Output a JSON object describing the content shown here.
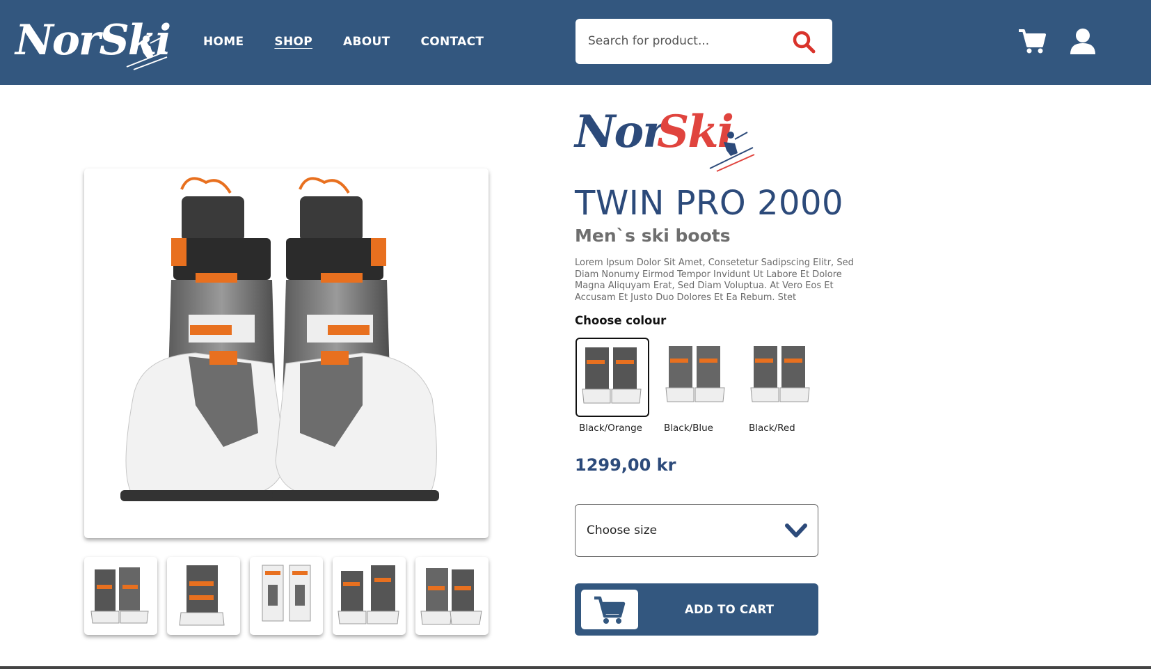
{
  "header": {
    "logo_text": "NorSki",
    "nav": [
      {
        "label": "HOME",
        "active": false
      },
      {
        "label": "SHOP",
        "active": true
      },
      {
        "label": "ABOUT",
        "active": false
      },
      {
        "label": "CONTACT",
        "active": false
      }
    ],
    "search": {
      "placeholder": "Search for product...",
      "icon": "search-icon"
    },
    "icons": {
      "cart": "cart-icon",
      "user": "user-icon"
    }
  },
  "product": {
    "brand_logo_text": {
      "nor": "Nor",
      "ski": "Ski"
    },
    "title": "TWIN PRO 2000",
    "subtitle": "Men`s ski boots",
    "description": "Lorem Ipsum Dolor Sit Amet, Consetetur Sadipscing Elitr, Sed Diam Nonumy Eirmod Tempor Invidunt Ut Labore Et Dolore Magna Aliquyam Erat, Sed Diam Voluptua. At Vero Eos Et Accusam Et Justo Duo Dolores Et Ea Rebum. Stet",
    "choose_colour_label": "Choose colour",
    "colours": [
      {
        "label": "Black/Orange",
        "accent": "#e8701f",
        "selected": true
      },
      {
        "label": "Black/Blue",
        "accent": "#e8701f",
        "selected": false
      },
      {
        "label": "Black/Red",
        "accent": "#e8701f",
        "selected": false
      }
    ],
    "price": "1299,00 kr",
    "size_select": {
      "label": "Choose size",
      "icon": "chevron-down-icon"
    },
    "add_to_cart": {
      "label": "ADD TO CART",
      "icon": "cart-icon"
    },
    "gallery_count": 5
  },
  "colors": {
    "primary": "#33577f",
    "brand_dark": "#2c4a7a",
    "brand_red": "#e0443e",
    "search_icon": "#d9332b",
    "boot_orange": "#e8701f"
  }
}
